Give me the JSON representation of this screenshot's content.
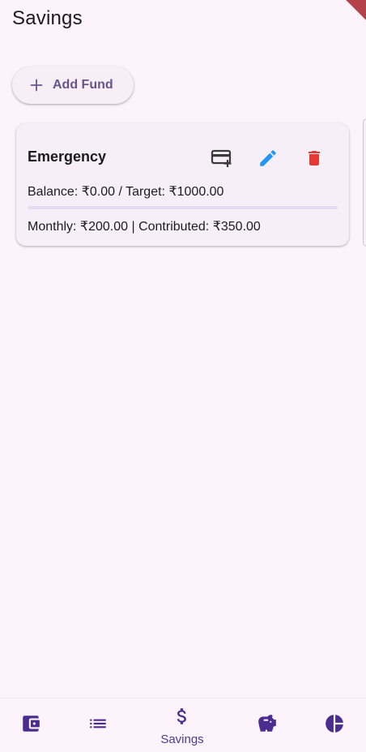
{
  "app": {
    "title": "Savings"
  },
  "actions": {
    "add_fund_label": "Add Fund"
  },
  "funds": [
    {
      "name": "Emergency",
      "balance_text": "Balance: ₹0.00 / Target: ₹1000.00",
      "progress_fraction": 0.0,
      "monthly_text": "Monthly: ₹200.00 | Contributed: ₹350.00"
    }
  ],
  "bottom_nav": {
    "active": "savings",
    "items": [
      {
        "icon": "wallet-icon",
        "label": ""
      },
      {
        "icon": "list-icon",
        "label": ""
      },
      {
        "icon": "dollar-icon",
        "label": "Savings"
      },
      {
        "icon": "piggy-bank-icon",
        "label": ""
      },
      {
        "icon": "pie-chart-icon",
        "label": ""
      }
    ]
  },
  "colors": {
    "background": "#fdf3fb",
    "accent": "#65558f",
    "nav_icon": "#4b2d8f",
    "edit": "#2196f3",
    "delete": "#e53935",
    "debug_banner": "#b3424a"
  }
}
